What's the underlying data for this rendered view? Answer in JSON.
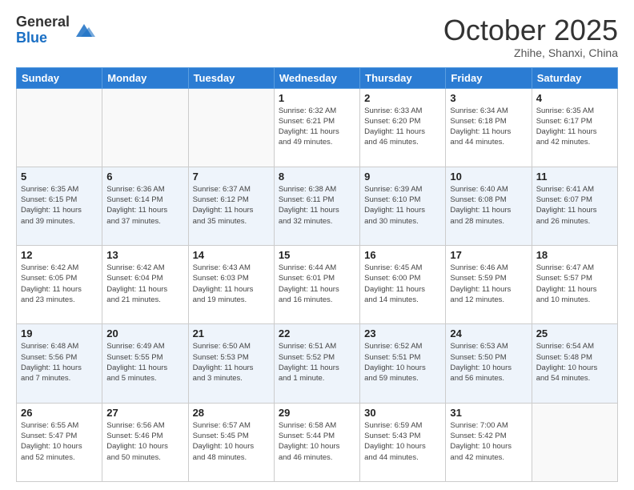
{
  "header": {
    "logo_general": "General",
    "logo_blue": "Blue",
    "month_title": "October 2025",
    "subtitle": "Zhihe, Shanxi, China"
  },
  "weekdays": [
    "Sunday",
    "Monday",
    "Tuesday",
    "Wednesday",
    "Thursday",
    "Friday",
    "Saturday"
  ],
  "weeks": [
    [
      {
        "day": "",
        "info": ""
      },
      {
        "day": "",
        "info": ""
      },
      {
        "day": "",
        "info": ""
      },
      {
        "day": "1",
        "info": "Sunrise: 6:32 AM\nSunset: 6:21 PM\nDaylight: 11 hours\nand 49 minutes."
      },
      {
        "day": "2",
        "info": "Sunrise: 6:33 AM\nSunset: 6:20 PM\nDaylight: 11 hours\nand 46 minutes."
      },
      {
        "day": "3",
        "info": "Sunrise: 6:34 AM\nSunset: 6:18 PM\nDaylight: 11 hours\nand 44 minutes."
      },
      {
        "day": "4",
        "info": "Sunrise: 6:35 AM\nSunset: 6:17 PM\nDaylight: 11 hours\nand 42 minutes."
      }
    ],
    [
      {
        "day": "5",
        "info": "Sunrise: 6:35 AM\nSunset: 6:15 PM\nDaylight: 11 hours\nand 39 minutes."
      },
      {
        "day": "6",
        "info": "Sunrise: 6:36 AM\nSunset: 6:14 PM\nDaylight: 11 hours\nand 37 minutes."
      },
      {
        "day": "7",
        "info": "Sunrise: 6:37 AM\nSunset: 6:12 PM\nDaylight: 11 hours\nand 35 minutes."
      },
      {
        "day": "8",
        "info": "Sunrise: 6:38 AM\nSunset: 6:11 PM\nDaylight: 11 hours\nand 32 minutes."
      },
      {
        "day": "9",
        "info": "Sunrise: 6:39 AM\nSunset: 6:10 PM\nDaylight: 11 hours\nand 30 minutes."
      },
      {
        "day": "10",
        "info": "Sunrise: 6:40 AM\nSunset: 6:08 PM\nDaylight: 11 hours\nand 28 minutes."
      },
      {
        "day": "11",
        "info": "Sunrise: 6:41 AM\nSunset: 6:07 PM\nDaylight: 11 hours\nand 26 minutes."
      }
    ],
    [
      {
        "day": "12",
        "info": "Sunrise: 6:42 AM\nSunset: 6:05 PM\nDaylight: 11 hours\nand 23 minutes."
      },
      {
        "day": "13",
        "info": "Sunrise: 6:42 AM\nSunset: 6:04 PM\nDaylight: 11 hours\nand 21 minutes."
      },
      {
        "day": "14",
        "info": "Sunrise: 6:43 AM\nSunset: 6:03 PM\nDaylight: 11 hours\nand 19 minutes."
      },
      {
        "day": "15",
        "info": "Sunrise: 6:44 AM\nSunset: 6:01 PM\nDaylight: 11 hours\nand 16 minutes."
      },
      {
        "day": "16",
        "info": "Sunrise: 6:45 AM\nSunset: 6:00 PM\nDaylight: 11 hours\nand 14 minutes."
      },
      {
        "day": "17",
        "info": "Sunrise: 6:46 AM\nSunset: 5:59 PM\nDaylight: 11 hours\nand 12 minutes."
      },
      {
        "day": "18",
        "info": "Sunrise: 6:47 AM\nSunset: 5:57 PM\nDaylight: 11 hours\nand 10 minutes."
      }
    ],
    [
      {
        "day": "19",
        "info": "Sunrise: 6:48 AM\nSunset: 5:56 PM\nDaylight: 11 hours\nand 7 minutes."
      },
      {
        "day": "20",
        "info": "Sunrise: 6:49 AM\nSunset: 5:55 PM\nDaylight: 11 hours\nand 5 minutes."
      },
      {
        "day": "21",
        "info": "Sunrise: 6:50 AM\nSunset: 5:53 PM\nDaylight: 11 hours\nand 3 minutes."
      },
      {
        "day": "22",
        "info": "Sunrise: 6:51 AM\nSunset: 5:52 PM\nDaylight: 11 hours\nand 1 minute."
      },
      {
        "day": "23",
        "info": "Sunrise: 6:52 AM\nSunset: 5:51 PM\nDaylight: 10 hours\nand 59 minutes."
      },
      {
        "day": "24",
        "info": "Sunrise: 6:53 AM\nSunset: 5:50 PM\nDaylight: 10 hours\nand 56 minutes."
      },
      {
        "day": "25",
        "info": "Sunrise: 6:54 AM\nSunset: 5:48 PM\nDaylight: 10 hours\nand 54 minutes."
      }
    ],
    [
      {
        "day": "26",
        "info": "Sunrise: 6:55 AM\nSunset: 5:47 PM\nDaylight: 10 hours\nand 52 minutes."
      },
      {
        "day": "27",
        "info": "Sunrise: 6:56 AM\nSunset: 5:46 PM\nDaylight: 10 hours\nand 50 minutes."
      },
      {
        "day": "28",
        "info": "Sunrise: 6:57 AM\nSunset: 5:45 PM\nDaylight: 10 hours\nand 48 minutes."
      },
      {
        "day": "29",
        "info": "Sunrise: 6:58 AM\nSunset: 5:44 PM\nDaylight: 10 hours\nand 46 minutes."
      },
      {
        "day": "30",
        "info": "Sunrise: 6:59 AM\nSunset: 5:43 PM\nDaylight: 10 hours\nand 44 minutes."
      },
      {
        "day": "31",
        "info": "Sunrise: 7:00 AM\nSunset: 5:42 PM\nDaylight: 10 hours\nand 42 minutes."
      },
      {
        "day": "",
        "info": ""
      }
    ]
  ]
}
